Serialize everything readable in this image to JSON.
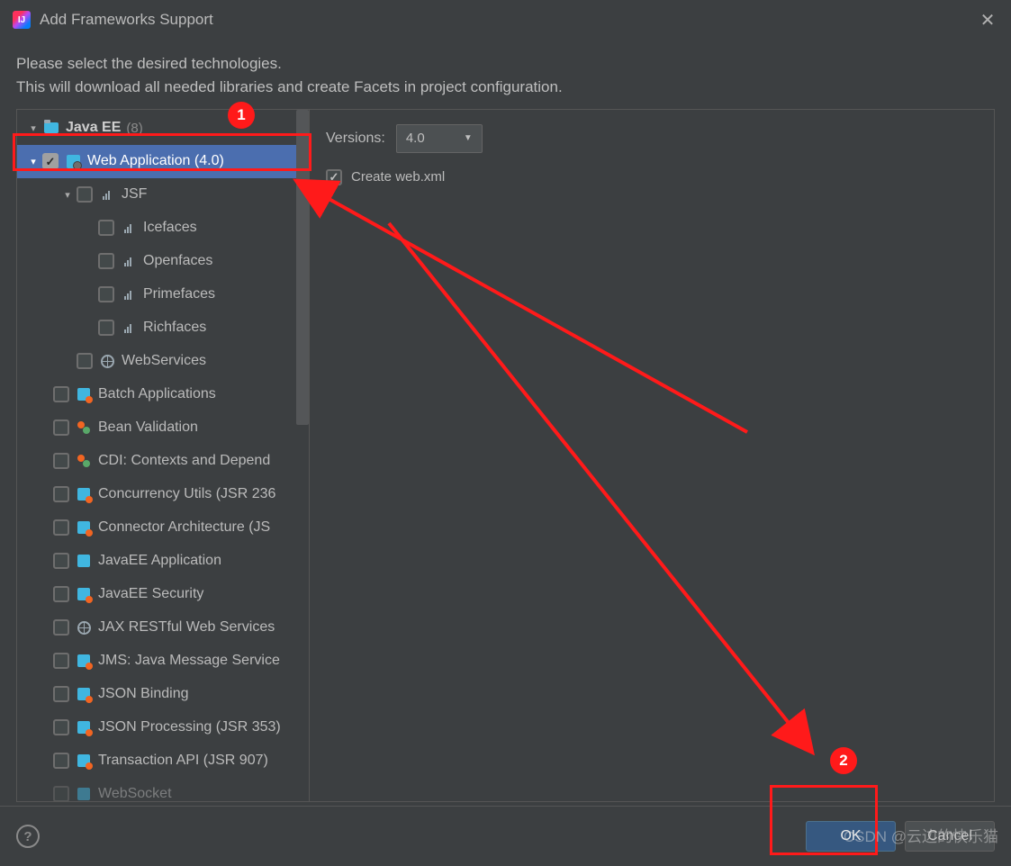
{
  "window": {
    "title": "Add Frameworks Support"
  },
  "instructions": {
    "line1": "Please select the desired technologies.",
    "line2": "This will download all needed libraries and create Facets in project configuration."
  },
  "tree": {
    "root": {
      "label": "Java EE",
      "count": "(8)"
    },
    "webapp": {
      "label": "Web Application (4.0)"
    },
    "jsf": {
      "label": "JSF"
    },
    "icefaces": {
      "label": "Icefaces"
    },
    "openfaces": {
      "label": "Openfaces"
    },
    "primefaces": {
      "label": "Primefaces"
    },
    "richfaces": {
      "label": "Richfaces"
    },
    "webservices": {
      "label": "WebServices"
    },
    "batch": {
      "label": "Batch Applications"
    },
    "beanval": {
      "label": "Bean Validation"
    },
    "cdi": {
      "label": "CDI: Contexts and Depend"
    },
    "concurrency": {
      "label": "Concurrency Utils (JSR 236"
    },
    "connector": {
      "label": "Connector Architecture (JS"
    },
    "javaeeapp": {
      "label": "JavaEE Application"
    },
    "javaeesec": {
      "label": "JavaEE Security"
    },
    "jaxrs": {
      "label": "JAX RESTful Web Services"
    },
    "jms": {
      "label": "JMS: Java Message Service"
    },
    "jsonb": {
      "label": "JSON Binding"
    },
    "jsonp": {
      "label": "JSON Processing (JSR 353)"
    },
    "txapi": {
      "label": "Transaction API (JSR 907)"
    },
    "websocket": {
      "label": "WebSocket"
    }
  },
  "right": {
    "versions_label": "Versions:",
    "version_value": "4.0",
    "create_webxml": "Create web.xml"
  },
  "buttons": {
    "ok": "OK",
    "cancel": "Cancel"
  },
  "annotations": {
    "badge1": "1",
    "badge2": "2"
  },
  "watermark": "CSDN @云边的快乐猫"
}
